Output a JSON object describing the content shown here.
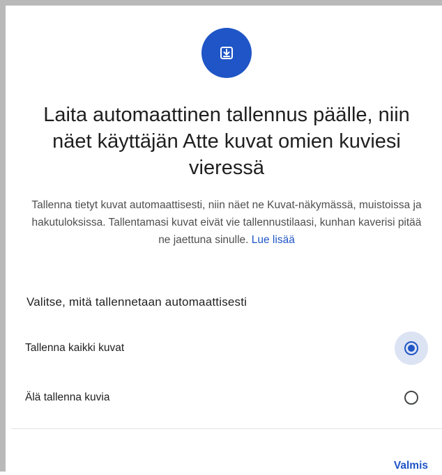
{
  "header": {
    "icon": "download-to-box-icon",
    "title": "Laita automaattinen tallennus päälle, niin näet käyttäjän Atte kuvat omien kuviesi vieressä"
  },
  "description": {
    "text": "Tallenna tietyt kuvat automaattisesti, niin näet ne Kuvat-näkymässä, muistoissa ja hakutuloksissa. Tallentamasi kuvat eivät vie tallennustilaasi, kunhan kaverisi pitää ne jaettuna sinulle.",
    "link_label": "Lue lisää"
  },
  "section": {
    "title": "Valitse, mitä tallennetaan automaattisesti"
  },
  "options": [
    {
      "label": "Tallenna kaikki kuvat",
      "selected": true
    },
    {
      "label": "Älä tallenna kuvia",
      "selected": false
    }
  ],
  "footer": {
    "done_label": "Valmis"
  },
  "colors": {
    "accent": "#1f55c6",
    "selected_halo": "#dce3f3",
    "frame": "#b9b9b9"
  }
}
